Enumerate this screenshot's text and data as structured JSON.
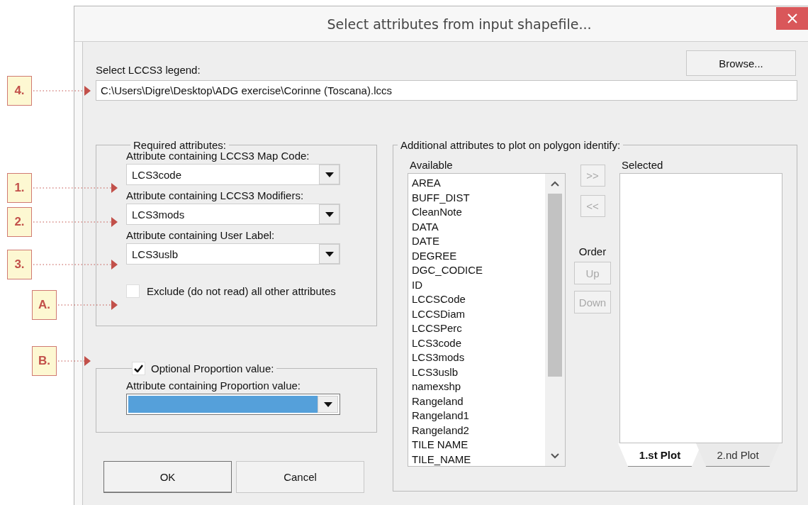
{
  "window": {
    "title": "Select attributes from input shapefile..."
  },
  "legend": {
    "label": "Select LCCS3 legend:",
    "browse_button": "Browse...",
    "path": "C:\\Users\\Digre\\Desktop\\ADG exercise\\Corinne (Toscana).lccs"
  },
  "required": {
    "title": "Required attributes:",
    "fields": [
      {
        "label": "Attribute containing LCCS3 Map Code:",
        "value": "LCS3code"
      },
      {
        "label": "Attribute containing LCCS3 Modifiers:",
        "value": "LCS3mods"
      },
      {
        "label": "Attribute containing User Label:",
        "value": "LCS3uslb"
      }
    ],
    "exclude": {
      "label": "Exclude (do not read) all other attributes",
      "checked": false
    }
  },
  "proportion": {
    "label": "Optional Proportion value:",
    "checked": true,
    "field_label": "Attribute containing Proportion value:",
    "focused": true
  },
  "buttons": [
    {
      "label": "OK",
      "default": true
    },
    {
      "label": "Cancel",
      "default": false
    }
  ],
  "additional": {
    "title": "Additional attributes to plot on polygon identify:",
    "available_label": "Available",
    "selected_label": "Selected",
    "order_label": "Order",
    "available": [
      "AREA",
      "BUFF_DIST",
      "CleanNote",
      "DATA",
      "DATE",
      "DEGREE",
      "DGC_CODICE",
      "ID",
      "LCCSCode",
      "LCCSDiam",
      "LCCSPerc",
      "LCS3code",
      "LCS3mods",
      "LCS3uslb",
      "namexshp",
      "Rangeland",
      "Rangeland1",
      "Rangeland2",
      "TILE NAME",
      "TILE_NAME"
    ],
    "move_buttons": [
      {
        "label": ">>",
        "disabled": true
      },
      {
        "label": "<<",
        "disabled": true
      }
    ],
    "order_buttons": [
      {
        "label": "Up",
        "disabled": true
      },
      {
        "label": "Down",
        "disabled": true
      }
    ],
    "tabs": [
      {
        "label": "1.st Plot",
        "selected": true
      },
      {
        "label": "2.nd Plot",
        "selected": false
      }
    ]
  },
  "callouts": [
    {
      "label": "4."
    },
    {
      "label": "1."
    },
    {
      "label": "2."
    },
    {
      "label": "3."
    },
    {
      "label": "A."
    },
    {
      "label": "B."
    }
  ]
}
